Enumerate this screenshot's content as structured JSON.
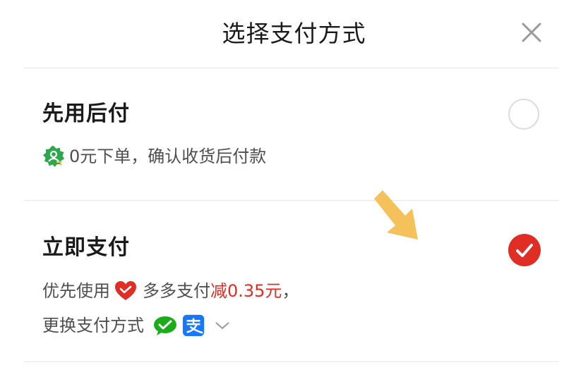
{
  "header": {
    "title": "选择支付方式",
    "close_icon": "close-icon"
  },
  "options": [
    {
      "title": "先用后付",
      "selected": false,
      "badge_icon": "pay-later-badge-icon",
      "description": "0元下单，确认收货后付款"
    },
    {
      "title": "立即支付",
      "selected": true,
      "line1": {
        "prefix": "优先使用",
        "wallet_icon": "heart-wallet-icon",
        "wallet_name": "多多支付",
        "discount": "减0.35元",
        "suffix": "，"
      },
      "line2": {
        "label": "更换支付方式",
        "wechat_icon": "wechat-pay-icon",
        "alipay_icon": "alipay-icon",
        "chevron_icon": "chevron-down-icon"
      }
    }
  ],
  "colors": {
    "accent_red": "#e02e24",
    "wechat_green": "#1aad19",
    "alipay_blue": "#1677ff",
    "badge_green": "#2aa84a",
    "arrow_gold": "#f4c15a"
  }
}
